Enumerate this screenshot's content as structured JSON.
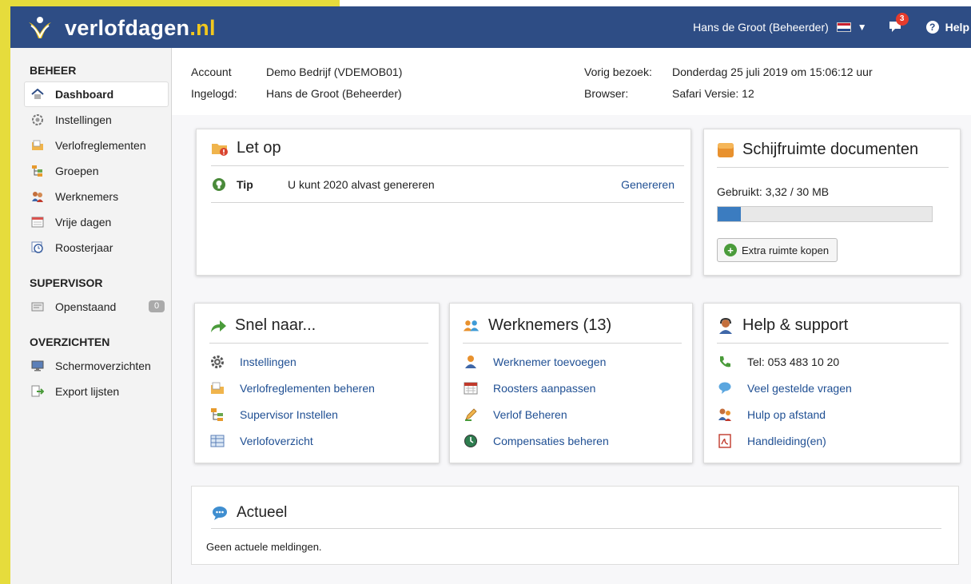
{
  "brand": {
    "name_main": "verlofdagen",
    "name_suffix": ".nl"
  },
  "topbar": {
    "user": "Hans de Groot (Beheerder)",
    "notifications": "3",
    "help_label": "Help"
  },
  "sidebar": {
    "sections": [
      {
        "title": "BEHEER",
        "items": [
          {
            "label": "Dashboard",
            "icon": "home-icon",
            "active": true
          },
          {
            "label": "Instellingen",
            "icon": "gear-icon"
          },
          {
            "label": "Verlofreglementen",
            "icon": "folder-icon"
          },
          {
            "label": "Groepen",
            "icon": "groups-icon"
          },
          {
            "label": "Werknemers",
            "icon": "people-icon"
          },
          {
            "label": "Vrije dagen",
            "icon": "calendar-icon"
          },
          {
            "label": "Roosterjaar",
            "icon": "clock-icon"
          }
        ]
      },
      {
        "title": "SUPERVISOR",
        "items": [
          {
            "label": "Openstaand",
            "icon": "inbox-icon",
            "count": "0"
          }
        ]
      },
      {
        "title": "OVERZICHTEN",
        "items": [
          {
            "label": "Schermoverzichten",
            "icon": "monitor-icon"
          },
          {
            "label": "Export lijsten",
            "icon": "export-icon"
          }
        ]
      }
    ]
  },
  "info": {
    "account_label": "Account",
    "account_value": "Demo Bedrijf  (VDEMOB01)",
    "loggedin_label": "Ingelogd:",
    "loggedin_value": "Hans de Groot (Beheerder)",
    "lastvisit_label": "Vorig bezoek:",
    "lastvisit_value": "Donderdag 25 juli 2019 om 15:06:12 uur",
    "browser_label": "Browser:",
    "browser_value": "Safari  Versie: 12"
  },
  "letop": {
    "title": "Let op",
    "tip_label": "Tip",
    "tip_text": "U kunt 2020 alvast genereren",
    "action": "Genereren"
  },
  "storage": {
    "title": "Schijfruimte documenten",
    "used_text": "Gebruikt: 3,32 / 30 MB",
    "used_fraction": 0.11,
    "button": "Extra ruimte kopen"
  },
  "snel": {
    "title": "Snel naar...",
    "links": [
      "Instellingen",
      "Verlofreglementen beheren",
      "Supervisor Instellen",
      "Verlofoverzicht"
    ]
  },
  "werknemers": {
    "title": "Werknemers (13)",
    "links": [
      "Werknemer toevoegen",
      "Roosters aanpassen",
      "Verlof Beheren",
      "Compensaties beheren"
    ]
  },
  "support": {
    "title": "Help & support",
    "phone": "Tel: 053 483 10 20",
    "links": [
      "Veel gestelde vragen",
      "Hulp op afstand",
      "Handleiding(en)"
    ]
  },
  "actueel": {
    "title": "Actueel",
    "message": "Geen actuele meldingen."
  }
}
